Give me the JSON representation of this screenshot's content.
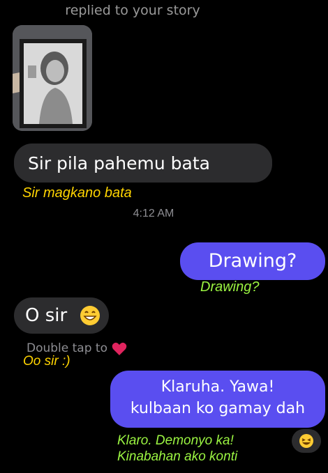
{
  "header": {
    "text": "replied to your story"
  },
  "messages": {
    "m1": {
      "text": "Sir pila pahemu bata",
      "translation": "Sir magkano bata"
    },
    "timestamp": "4:12 AM",
    "m2": {
      "text": "Drawing?",
      "translation": "Drawing?"
    },
    "m3": {
      "text": "O sir",
      "translation": "Oo sir :)",
      "hint": "Double tap to"
    },
    "m4": {
      "line1": "Klaruha. Yawa!",
      "line2": "kulbaan ko gamay dah",
      "translation_line1": "Klaro. Demonyo ka!",
      "translation_line2": "Kinabahan ako konti"
    }
  },
  "icons": {
    "grin": "grinning-face-icon",
    "heart": "heart-icon",
    "laugh": "laughing-face-icon"
  },
  "colors": {
    "incoming_bubble": "#2c2c2e",
    "outgoing_bubble": "#5a4ef0",
    "translation_yellow": "#ffd400",
    "translation_green": "#9bf542"
  }
}
